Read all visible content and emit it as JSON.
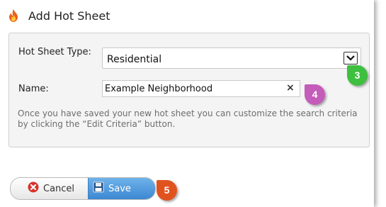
{
  "dialog": {
    "title": "Add Hot Sheet",
    "icon": "fire-icon"
  },
  "form": {
    "type_label": "Hot Sheet Type:",
    "type_value": "Residential",
    "name_label": "Name:",
    "name_value": "Example Neighborhood",
    "clear_label": "×",
    "help_text": "Once you have saved your new hot sheet you can customize the search criteria by clicking the “Edit Criteria” button."
  },
  "buttons": {
    "cancel_label": "Cancel",
    "cancel_icon": "cancel-circle-icon",
    "save_label": "Save",
    "save_icon": "floppy-disk-icon"
  },
  "markers": [
    {
      "label": "3",
      "color": "#3fbf3f"
    },
    {
      "label": "4",
      "color": "#c45cba"
    },
    {
      "label": "5",
      "color": "#e0531f"
    }
  ],
  "colors": {
    "save_button": "#4a90d9",
    "panel_background": "#f4f4f4",
    "help_text": "#6d6d6d"
  }
}
